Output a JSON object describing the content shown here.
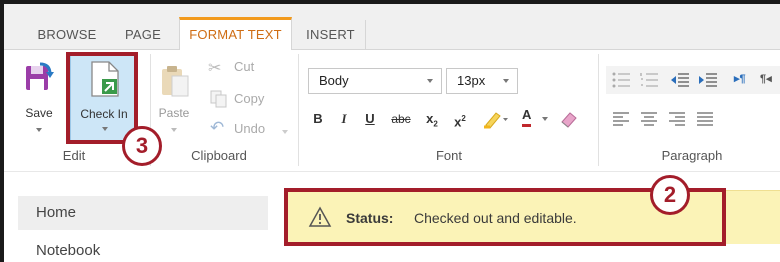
{
  "tabs": [
    {
      "label": "BROWSE"
    },
    {
      "label": "PAGE"
    },
    {
      "label": "FORMAT TEXT"
    },
    {
      "label": "INSERT"
    }
  ],
  "active_tab": "FORMAT TEXT",
  "ribbon": {
    "edit_group": {
      "label": "Edit",
      "save_label": "Save",
      "checkin_label": "Check In"
    },
    "clipboard_group": {
      "label": "Clipboard",
      "paste_label": "Paste",
      "cut_label": "Cut",
      "copy_label": "Copy",
      "undo_label": "Undo"
    },
    "font_group": {
      "label": "Font",
      "style_value": "Body",
      "size_value": "13px",
      "bold": "B",
      "italic": "I",
      "underline": "U",
      "strike": "abc",
      "subscript": "x",
      "subscript_mark": "2",
      "superscript": "x",
      "superscript_mark": "2",
      "font_color_letter": "A"
    },
    "paragraph_group": {
      "label": "Paragraph"
    }
  },
  "callouts": {
    "step_checkin": "3",
    "step_status": "2"
  },
  "nav": {
    "items": [
      {
        "label": "Home"
      },
      {
        "label": "Notebook"
      }
    ]
  },
  "status_bar": {
    "label": "Status:",
    "text": "Checked out and editable."
  },
  "colors": {
    "accent": "#f29a1d",
    "callout": "#a31d2a",
    "status_bg": "#fbf3b7",
    "checkin_highlight": "#cde6f7"
  }
}
